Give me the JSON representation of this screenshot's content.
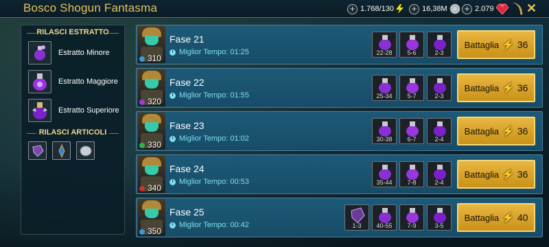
{
  "header": {
    "title": "Bosco Shogun Fantasma",
    "energy": "1.768/130",
    "silver": "16,38M",
    "gems": "2.079",
    "colors": {
      "accent": "#e6c25c",
      "energy": "#f5e400",
      "gem": "#e0283c"
    }
  },
  "left_panel": {
    "extract_title": "RILASCI ESTRATTO",
    "extracts": [
      {
        "label": "Estratto Minore",
        "icon": "potion-small-icon"
      },
      {
        "label": "Estratto Maggiore",
        "icon": "potion-large-icon"
      },
      {
        "label": "Estratto Superiore",
        "icon": "potion-superior-icon"
      }
    ],
    "artifacts_title": "RILASCI ARTICOLI",
    "artifacts": [
      "gloves-artifact-icon",
      "ring-artifact-icon",
      "silver-coin-icon"
    ]
  },
  "stages": [
    {
      "name": "Fase 21",
      "time_label": "Miglior Tempo:",
      "time": "01:25",
      "level": "310",
      "drops": [
        "22-28",
        "5-6",
        "2-3"
      ],
      "extra_drop": null,
      "battle_label": "Battaglia",
      "cost": "36"
    },
    {
      "name": "Fase 22",
      "time_label": "Miglior Tempo:",
      "time": "01:55",
      "level": "320",
      "drops": [
        "25-34",
        "5-7",
        "2-3"
      ],
      "extra_drop": null,
      "battle_label": "Battaglia",
      "cost": "36"
    },
    {
      "name": "Fase 23",
      "time_label": "Miglior Tempo:",
      "time": "01:02",
      "level": "330",
      "drops": [
        "30-38",
        "6-7",
        "2-4"
      ],
      "extra_drop": null,
      "battle_label": "Battaglia",
      "cost": "36"
    },
    {
      "name": "Fase 24",
      "time_label": "Miglior Tempo:",
      "time": "00:53",
      "level": "340",
      "drops": [
        "35-44",
        "7-8",
        "2-4"
      ],
      "extra_drop": null,
      "battle_label": "Battaglia",
      "cost": "36"
    },
    {
      "name": "Fase 25",
      "time_label": "Miglior Tempo:",
      "time": "00:42",
      "level": "350",
      "drops": [
        "40-55",
        "7-9",
        "3-5"
      ],
      "extra_drop": "1-3",
      "battle_label": "Battaglia",
      "cost": "40"
    }
  ]
}
